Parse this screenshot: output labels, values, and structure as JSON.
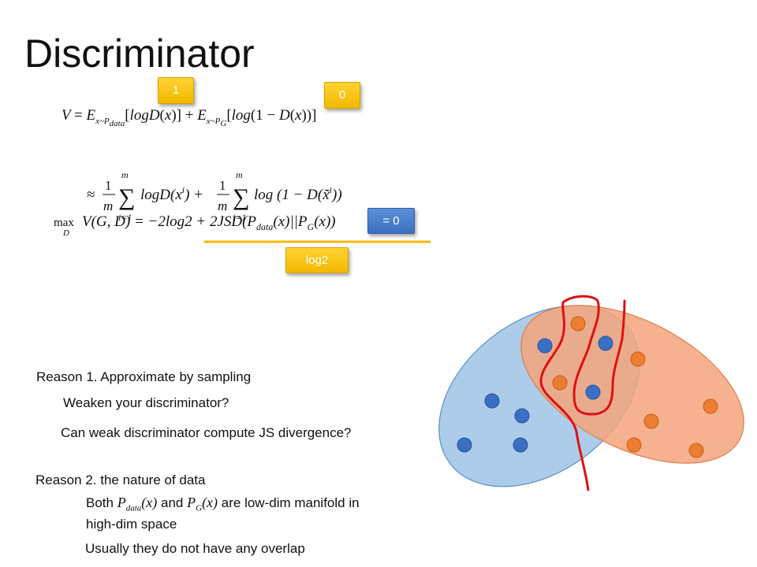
{
  "title": "Discriminator",
  "colors": {
    "yellow_tag": "#f2b800",
    "blue_tag": "#3c6fc2",
    "divider": "#f5b800",
    "blue_ellipse": "#9dc3e6",
    "orange_ellipse": "#f4a57c",
    "blue_point": "#3a6fc4",
    "orange_point": "#ed7d31",
    "red_curve": "#e01010"
  },
  "tags": {
    "tag_one": "1",
    "tag_zero": "0",
    "tag_eq_zero": "= 0",
    "tag_log2": "log2"
  },
  "equations": {
    "v_definition": "V = E_{x~P_data}[logD(x)] + E_{x~P_G}[log(1 − D(x))]",
    "approximation": "≈ (1/m) Σ_{i=1}^{m} logD(x^i) + (1/m) Σ_{i=1}^{m} log(1 − D(x̃^i))",
    "max_objective": "max_D V(G,D) = −2log2 + 2JSD(P_data(x)||P_G(x))"
  },
  "reasons": {
    "reason1": "Reason 1. Approximate by sampling",
    "weaken": "Weaken your discriminator?",
    "weak_js": "Can weak discriminator compute JS divergence?",
    "reason2": "Reason 2. the nature of data",
    "both_prefix": "Both",
    "both_and": "and",
    "both_suffix": "are low-dim manifold in",
    "high_dim": "high-dim space",
    "overlap": "Usually they do not have any overlap"
  },
  "icons": {
    "ellipses": "distribution-ellipse-icon",
    "curve": "decision-boundary-curve-icon"
  }
}
